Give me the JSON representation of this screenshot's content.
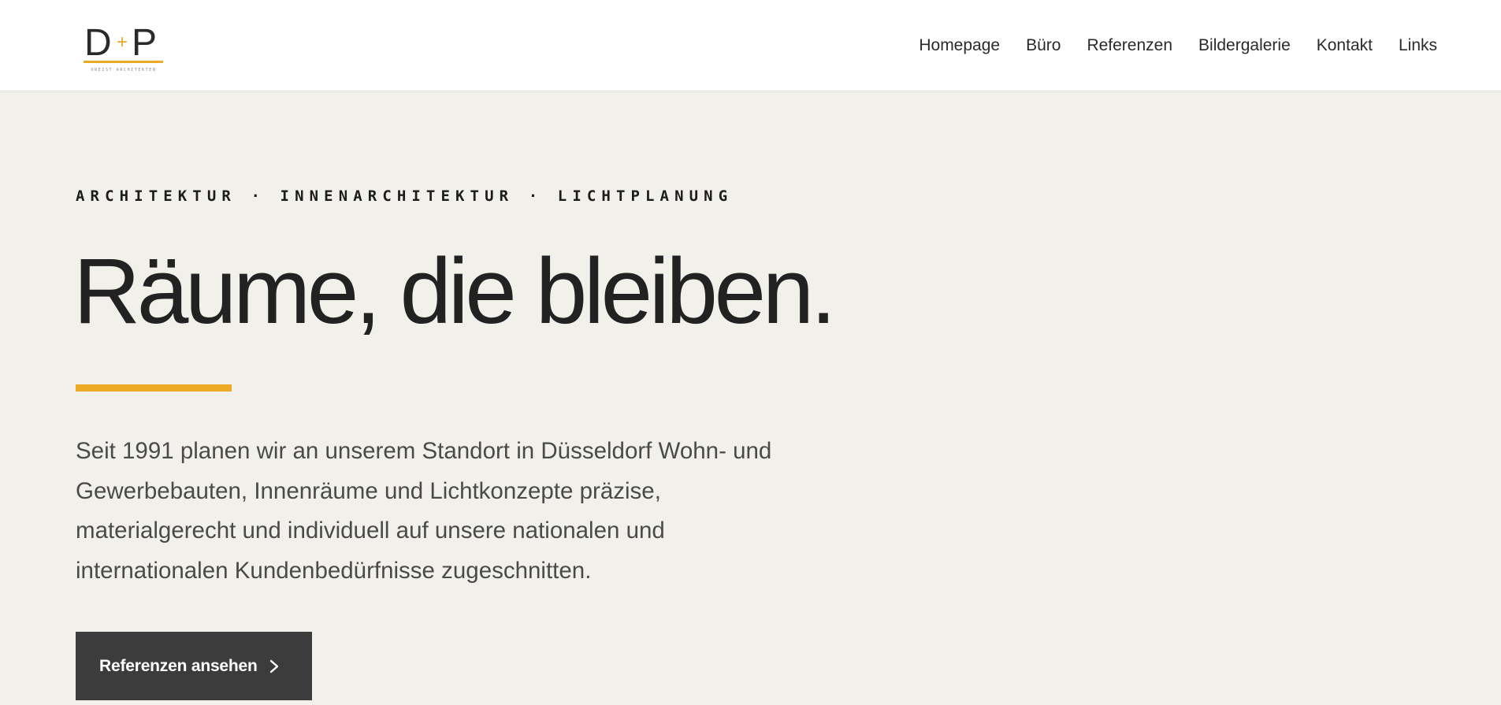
{
  "header": {
    "logo": {
      "mark": "D+P",
      "tagline": "DREIST ARCHITEKTEN",
      "accent_color": "#eba924"
    },
    "nav": [
      {
        "label": "Homepage"
      },
      {
        "label": "Büro"
      },
      {
        "label": "Referenzen"
      },
      {
        "label": "Bildergalerie"
      },
      {
        "label": "Kontakt"
      },
      {
        "label": "Links"
      }
    ]
  },
  "hero": {
    "eyebrow": "ARCHITEKTUR · INNENARCHITEKTUR · LICHTPLANUNG",
    "headline": "Räume, die bleiben.",
    "accent_color": "#eba924",
    "intro_lines": [
      "Seit 1991 planen wir an unserem Standort in Düsseldorf Wohn- und",
      "Gewerbebauten, Innenräume und Lichtkonzepte präzise,",
      "materialgerecht und individuell auf unsere nationalen und",
      "internationalen Kundenbedürfnisse zugeschnitten."
    ],
    "cta": {
      "label": "Referenzen ansehen",
      "icon": "chevron-right-icon"
    }
  },
  "colors": {
    "background": "#f2f0eb",
    "header_bg": "#ffffff",
    "button_bg": "#3c3c3c",
    "text": "#222222"
  }
}
